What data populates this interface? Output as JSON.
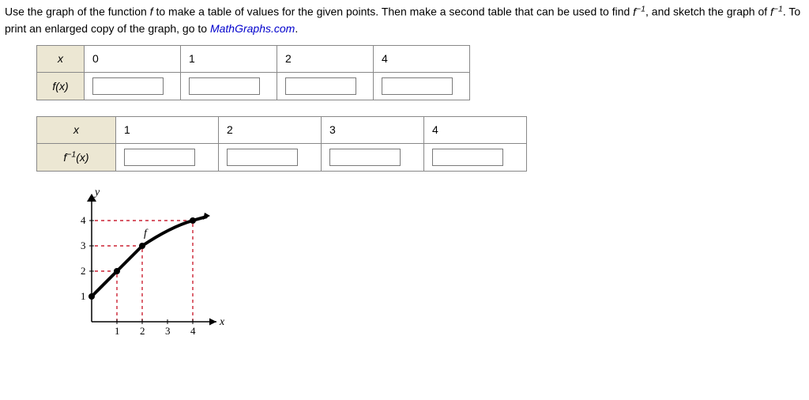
{
  "prompt": {
    "part1": "Use the graph of the function ",
    "fsym": "f",
    "part2": " to make a table of values for the given points. Then make a second table that can be used to find  ",
    "finv1": "f",
    "finv1_exp": "−1",
    "part3": ",  and sketch the graph of  ",
    "finv2": "f",
    "finv2_exp": "−1",
    "part4": ".  To print an enlarged copy of the graph, go to ",
    "link": "MathGraphs.com",
    "part5": "."
  },
  "table1": {
    "row_x_label": "x",
    "row_fx_label": "f(x)",
    "x_values": [
      "0",
      "1",
      "2",
      "4"
    ]
  },
  "table2": {
    "row_x_label": "x",
    "row_finv_label_f": "f",
    "row_finv_label_exp": "−1",
    "row_finv_label_x": "(x)",
    "x_values": [
      "1",
      "2",
      "3",
      "4"
    ]
  },
  "chart_data": {
    "type": "line",
    "title": "",
    "xlabel": "x",
    "ylabel": "y",
    "curve_label": "f",
    "xlim": [
      0,
      5
    ],
    "ylim": [
      0,
      5
    ],
    "xticks": [
      1,
      2,
      3,
      4
    ],
    "yticks": [
      1,
      2,
      3,
      4
    ],
    "series": [
      {
        "name": "f",
        "points": [
          [
            0,
            1
          ],
          [
            1,
            2
          ],
          [
            2,
            3
          ],
          [
            4,
            4
          ]
        ]
      }
    ],
    "guidelines": [
      {
        "from": [
          1,
          0
        ],
        "to": [
          1,
          2
        ],
        "to2": [
          0,
          2
        ]
      },
      {
        "from": [
          2,
          0
        ],
        "to": [
          2,
          3
        ],
        "to2": [
          0,
          3
        ]
      },
      {
        "from": [
          4,
          0
        ],
        "to": [
          4,
          4
        ],
        "to2": [
          0,
          4
        ]
      }
    ]
  }
}
